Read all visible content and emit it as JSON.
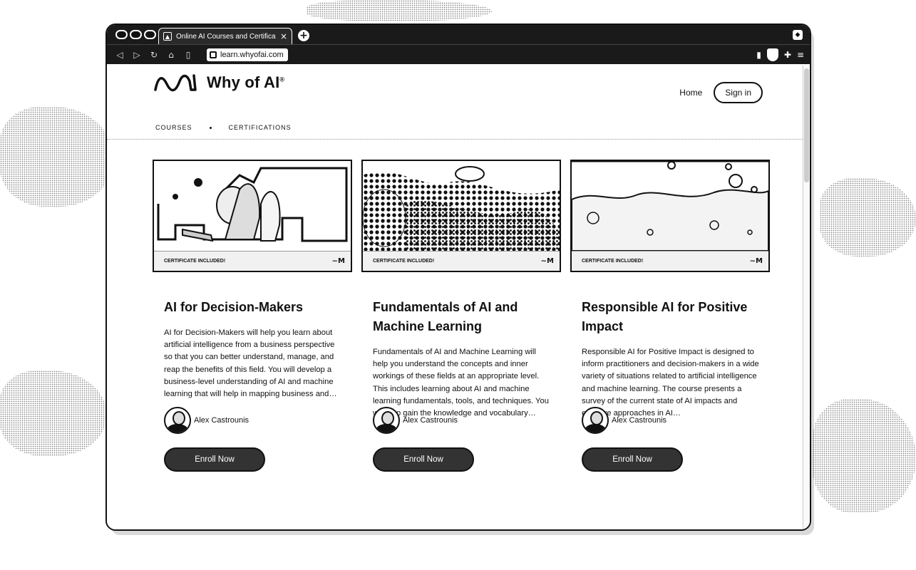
{
  "browser": {
    "tab_title": "Online AI Courses and Certifica",
    "tab_close": "×",
    "new_tab": "+",
    "url": "learn.whyofai.com"
  },
  "site": {
    "brand": "Why of AI",
    "brand_mark": "®",
    "nav": {
      "courses": "COURSES",
      "certifications": "CERTIFICATIONS"
    },
    "home": "Home",
    "sign_in": "Sign in"
  },
  "cards": [
    {
      "badge": "CERTIFICATE INCLUDED!",
      "title": "AI for Decision-Makers",
      "description": "AI for Decision-Makers will help you learn about artificial intelligence from a business perspective so that you can better understand, manage, and reap the benefits of this field. You will develop a business-level understanding of AI and machine learning that will help in mapping business and…",
      "author": "Alex Castrounis",
      "cta": "Enroll Now"
    },
    {
      "badge": "CERTIFICATE INCLUDED!",
      "title": "Fundamentals of AI and Machine Learning",
      "description": "Fundamentals of AI and Machine Learning will help you understand the concepts and inner workings of these fields at an appropriate level. This includes learning about AI and machine learning fundamentals, tools, and techniques. You will also gain the knowledge and vocabulary…",
      "author": "Alex Castrounis",
      "cta": "Enroll Now"
    },
    {
      "badge": "CERTIFICATE INCLUDED!",
      "title": "Responsible AI for Positive Impact",
      "description": "Responsible AI for Positive Impact is designed to inform practitioners and decision-makers in a wide variety of situations related to artificial intelligence and machine learning. The course presents a survey of the current state of AI impacts and effective approaches in AI…",
      "author": "Alex Castrounis",
      "cta": "Enroll Now"
    }
  ]
}
